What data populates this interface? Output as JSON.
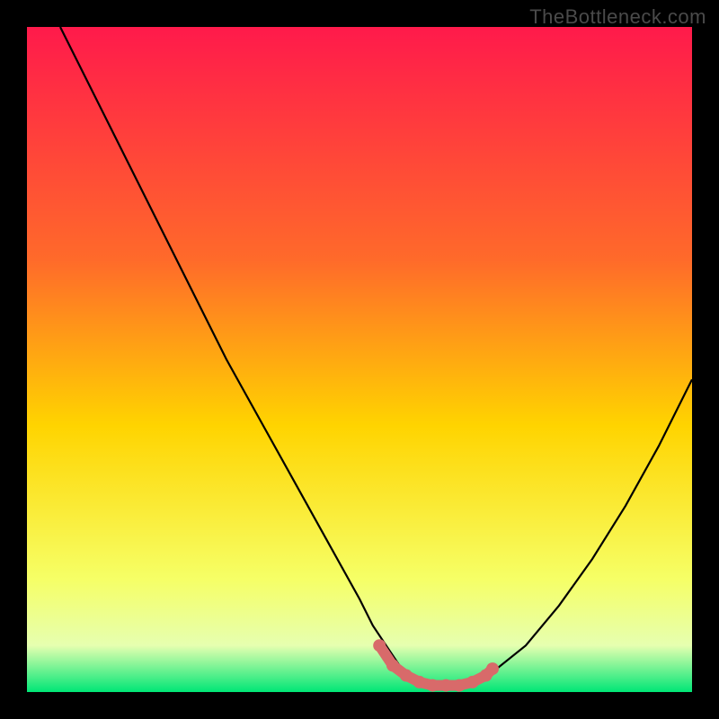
{
  "watermark": "TheBottleneck.com",
  "colors": {
    "frame": "#000000",
    "curve": "#000000",
    "marker_fill": "#d86a6a",
    "marker_stroke": "#d86a6a",
    "grad_top": "#ff1a4b",
    "grad_mid_top": "#ff6a2a",
    "grad_mid": "#ffd400",
    "grad_low1": "#f6ff66",
    "grad_low2": "#e6ffb0",
    "grad_bottom": "#00e676"
  },
  "chart_data": {
    "type": "line",
    "title": "",
    "xlabel": "",
    "ylabel": "",
    "xlim": [
      0,
      100
    ],
    "ylim": [
      0,
      100
    ],
    "x": [
      5,
      10,
      15,
      20,
      25,
      30,
      35,
      40,
      45,
      50,
      52,
      54,
      56,
      58,
      60,
      62,
      64,
      66,
      68,
      70,
      75,
      80,
      85,
      90,
      95,
      100
    ],
    "values": [
      100,
      90,
      80,
      70,
      60,
      50,
      41,
      32,
      23,
      14,
      10,
      7,
      4,
      2,
      1,
      1,
      1,
      1,
      2,
      3,
      7,
      13,
      20,
      28,
      37,
      47
    ],
    "marker_points": [
      {
        "x": 53,
        "y": 7
      },
      {
        "x": 55,
        "y": 4
      },
      {
        "x": 57,
        "y": 2.5
      },
      {
        "x": 59,
        "y": 1.5
      },
      {
        "x": 61,
        "y": 1
      },
      {
        "x": 63,
        "y": 1
      },
      {
        "x": 65,
        "y": 1
      },
      {
        "x": 67,
        "y": 1.5
      },
      {
        "x": 69,
        "y": 2.5
      },
      {
        "x": 70,
        "y": 3.5
      }
    ],
    "background_gradient_stops": [
      {
        "offset": 0.0,
        "colorKey": "grad_top"
      },
      {
        "offset": 0.35,
        "colorKey": "grad_mid_top"
      },
      {
        "offset": 0.6,
        "colorKey": "grad_mid"
      },
      {
        "offset": 0.83,
        "colorKey": "grad_low1"
      },
      {
        "offset": 0.93,
        "colorKey": "grad_low2"
      },
      {
        "offset": 1.0,
        "colorKey": "grad_bottom"
      }
    ]
  }
}
